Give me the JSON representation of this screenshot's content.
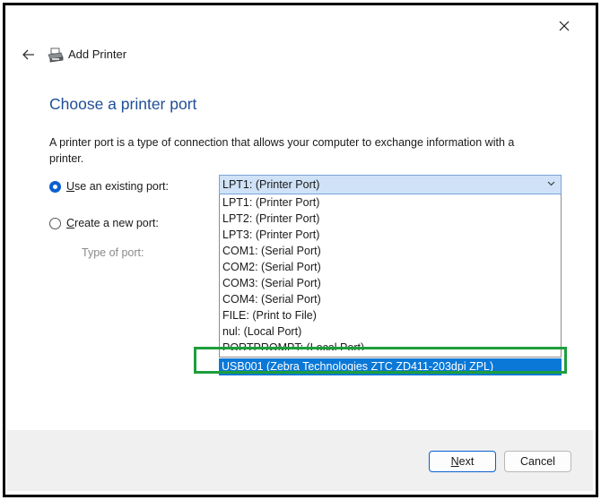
{
  "window": {
    "title": "Add Printer",
    "close_icon": "close-icon",
    "back_icon": "back-arrow-icon",
    "printer_icon": "printer-icon"
  },
  "page": {
    "heading": "Choose a printer port",
    "description": "A printer port is a type of connection that allows your computer to exchange information with a printer."
  },
  "options": {
    "existing_port": {
      "prefix": "U",
      "rest": "se an existing port:",
      "checked": true
    },
    "new_port": {
      "prefix": "C",
      "rest": "reate a new port:",
      "checked": false
    },
    "type_of_port_label": "Type of port:"
  },
  "port_select": {
    "value": "LPT1: (Printer Port)",
    "items": [
      "LPT1: (Printer Port)",
      "LPT2: (Printer Port)",
      "LPT3: (Printer Port)",
      "COM1: (Serial Port)",
      "COM2: (Serial Port)",
      "COM3: (Serial Port)",
      "COM4: (Serial Port)",
      "FILE: (Print to File)",
      "nul: (Local Port)",
      "PORTPROMPT: (Local Port)"
    ],
    "highlighted_item": "USB001 (Zebra Technologies ZTC ZD411-203dpi ZPL)"
  },
  "buttons": {
    "next": {
      "prefix": "N",
      "rest": "ext"
    },
    "cancel": "Cancel"
  },
  "colors": {
    "heading": "#1f4e96",
    "accent": "#0a78d7",
    "annotation_box": "#1e9e3c"
  }
}
